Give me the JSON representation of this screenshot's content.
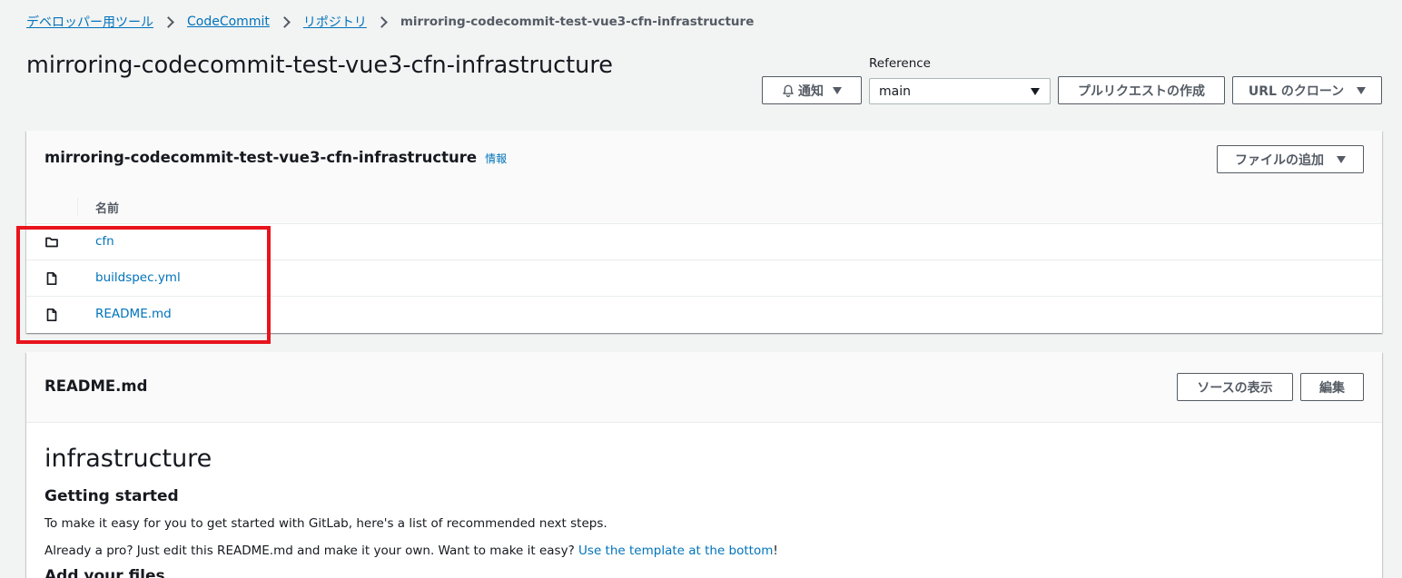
{
  "breadcrumb": {
    "items": [
      "デベロッパー用ツール",
      "CodeCommit",
      "リポジトリ"
    ],
    "current": "mirroring-codecommit-test-vue3-cfn-infrastructure"
  },
  "page": {
    "title": "mirroring-codecommit-test-vue3-cfn-infrastructure"
  },
  "actions": {
    "notify_label": "通知",
    "reference_label": "Reference",
    "reference_value": "main",
    "pull_request_label": "プルリクエストの作成",
    "clone_url_label": "URL のクローン"
  },
  "files_panel": {
    "title": "mirroring-codecommit-test-vue3-cfn-infrastructure",
    "info_label": "情報",
    "add_file_label": "ファイルの追加",
    "column_name": "名前",
    "rows": [
      {
        "name": "cfn",
        "icon": "folder-icon"
      },
      {
        "name": "buildspec.yml",
        "icon": "file-icon"
      },
      {
        "name": "README.md",
        "icon": "file-icon"
      }
    ]
  },
  "readme_panel": {
    "title": "README.md",
    "view_source_label": "ソースの表示",
    "edit_label": "編集",
    "h1": "infrastructure",
    "h2": "Getting started",
    "p1": "To make it easy for you to get started with GitLab, here's a list of recommended next steps.",
    "p2_text": "Already a pro? Just edit this README.md and make it your own. Want to make it easy? ",
    "p2_link": "Use the template at the bottom",
    "p2_end": "!",
    "h2_next": "Add your files"
  },
  "colors": {
    "link": "#0073bb",
    "highlight": "#e8141c",
    "text": "#16191f"
  }
}
